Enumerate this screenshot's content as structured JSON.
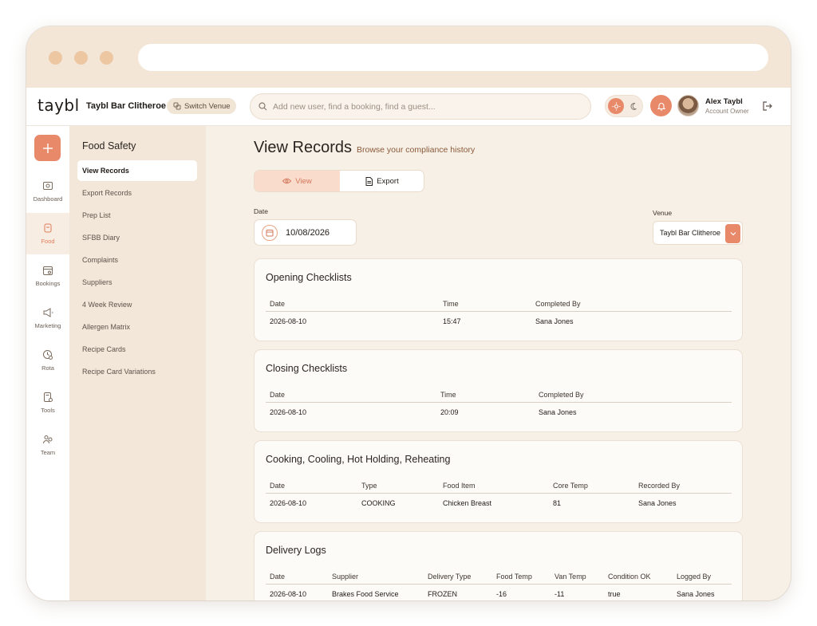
{
  "colors": {
    "accent": "#e8896a",
    "background": "#f7f0e6",
    "sidebar": "#f3e7d9"
  },
  "topbar": {
    "logo": "taybl",
    "venue_name": "Taybl Bar Clitheroe",
    "switch_venue": "Switch Venue",
    "search_placeholder": "Add new user, find a booking, find a guest...",
    "user_name": "Alex Taybl",
    "user_role": "Account Owner"
  },
  "rail": {
    "items": [
      {
        "label": "Dashboard",
        "icon": "dashboard-icon"
      },
      {
        "label": "Food",
        "icon": "food-icon",
        "active": true
      },
      {
        "label": "Bookings",
        "icon": "bookings-icon"
      },
      {
        "label": "Marketing",
        "icon": "marketing-icon"
      },
      {
        "label": "Rota",
        "icon": "rota-icon"
      },
      {
        "label": "Tools",
        "icon": "tools-icon"
      },
      {
        "label": "Team",
        "icon": "team-icon"
      }
    ]
  },
  "subnav": {
    "title": "Food Safety",
    "items": [
      "View Records",
      "Export Records",
      "Prep List",
      "SFBB Diary",
      "Complaints",
      "Suppliers",
      "4 Week Review",
      "Allergen Matrix",
      "Recipe Cards",
      "Recipe Card Variations"
    ],
    "active": "View Records"
  },
  "main": {
    "title": "View Records",
    "subtitle": "Browse your compliance history",
    "toggle": {
      "view": "View",
      "export": "Export"
    },
    "date_label": "Date",
    "date_value": "10/08/2026",
    "venue_label": "Venue",
    "venue_value": "Taybl Bar Clitheroe"
  },
  "cards": {
    "opening": {
      "title": "Opening Checklists",
      "headers": [
        "Date",
        "Time",
        "Completed By"
      ],
      "row": [
        "2026-08-10",
        "15:47",
        "Sana Jones"
      ]
    },
    "closing": {
      "title": "Closing Checklists",
      "headers": [
        "Date",
        "Time",
        "Completed By"
      ],
      "row": [
        "2026-08-10",
        "20:09",
        "Sana Jones"
      ]
    },
    "cooking": {
      "title": "Cooking, Cooling, Hot Holding, Reheating",
      "headers": [
        "Date",
        "Type",
        "Food Item",
        "Core Temp",
        "Recorded By"
      ],
      "row": [
        "2026-08-10",
        "COOKING",
        "Chicken Breast",
        "81",
        "Sana Jones"
      ]
    },
    "delivery": {
      "title": "Delivery Logs",
      "headers": [
        "Date",
        "Supplier",
        "Delivery Type",
        "Food Temp",
        "Van Temp",
        "Condition OK",
        "Logged By"
      ],
      "row": [
        "2026-08-10",
        "Brakes Food Service",
        "FROZEN",
        "-16",
        "-11",
        "true",
        "Sana Jones"
      ]
    }
  }
}
